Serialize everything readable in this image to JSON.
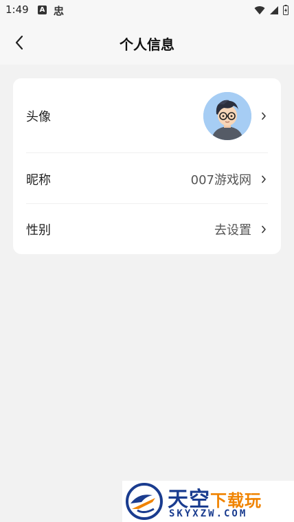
{
  "status_bar": {
    "time": "1:49",
    "notif_a": "A",
    "app_glyph": "忠",
    "icons": [
      "wifi-icon",
      "signal-icon",
      "battery-icon"
    ]
  },
  "header": {
    "title": "个人信息",
    "back_icon": "chevron-left-icon"
  },
  "profile": {
    "rows": [
      {
        "label": "头像",
        "value": ""
      },
      {
        "label": "昵称",
        "value": "007游戏网"
      },
      {
        "label": "性别",
        "value": "去设置"
      }
    ]
  },
  "watermark": {
    "title_part1": "天空",
    "title_part2": "下载玩",
    "subtitle": "SKYXZW.COM"
  },
  "colors": {
    "background": "#f2f2f2",
    "card": "#ffffff",
    "avatar_bg": "#a6cdf4",
    "watermark_blue": "#1a3c8f",
    "watermark_orange": "#f08300"
  }
}
